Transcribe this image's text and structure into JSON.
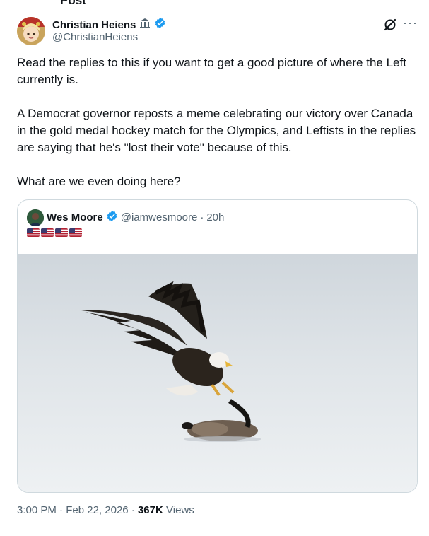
{
  "header": {
    "title": "Post"
  },
  "author": {
    "name": "Christian Heiens",
    "handle": "@ChristianHeiens",
    "badge_icon": "government-building-icon",
    "verified_icon": "verified-badge-icon",
    "verified_color": "#1d9bf0"
  },
  "actions": {
    "grok_icon": "grok-icon",
    "more_icon": "more-options-icon"
  },
  "tweet": {
    "paragraphs": [
      "Read the replies to this if you want to get a good picture of where the Left currently is.",
      "A Democrat governor reposts a meme celebrating our victory over Canada in the gold medal hockey match for the Olympics, and Leftists in the replies are saying that he's \"lost their vote\" because of this.",
      "What are we even doing here?"
    ]
  },
  "quoted_post": {
    "name": "Wes Moore",
    "handle": "@iamwesmoore",
    "separator": "·",
    "age": "20h",
    "text_emoji": [
      "us-flag",
      "us-flag",
      "us-flag",
      "us-flag"
    ],
    "image_subject": "bald eagle swooping down onto a goose on snow"
  },
  "meta": {
    "time": "3:00 PM",
    "separator": "·",
    "date": "Feb 22, 2026",
    "views_count": "367K",
    "views_label": "Views"
  }
}
